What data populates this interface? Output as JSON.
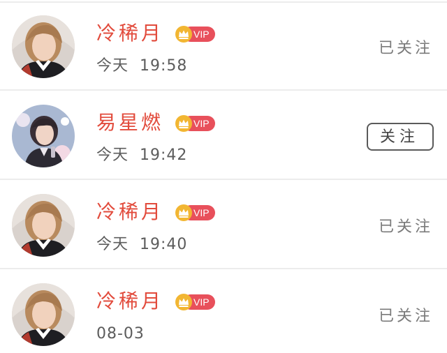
{
  "rows": [
    {
      "name": "冷稀月",
      "vip": "VIP",
      "time": "今天  19:58",
      "status": "已关注",
      "followed": true
    },
    {
      "name": "易星燃",
      "vip": "VIP",
      "time": "今天  19:42",
      "button": "关注",
      "followed": false
    },
    {
      "name": "冷稀月",
      "vip": "VIP",
      "time": "今天  19:40",
      "status": "已关注",
      "followed": true
    },
    {
      "name": "冷稀月",
      "vip": "VIP",
      "time": "08-03",
      "status": "已关注",
      "followed": true
    }
  ],
  "colors": {
    "name": "#e24b3c",
    "vip_badge": "#e8505b",
    "crown": "#f2b632",
    "divider": "#ececec"
  }
}
